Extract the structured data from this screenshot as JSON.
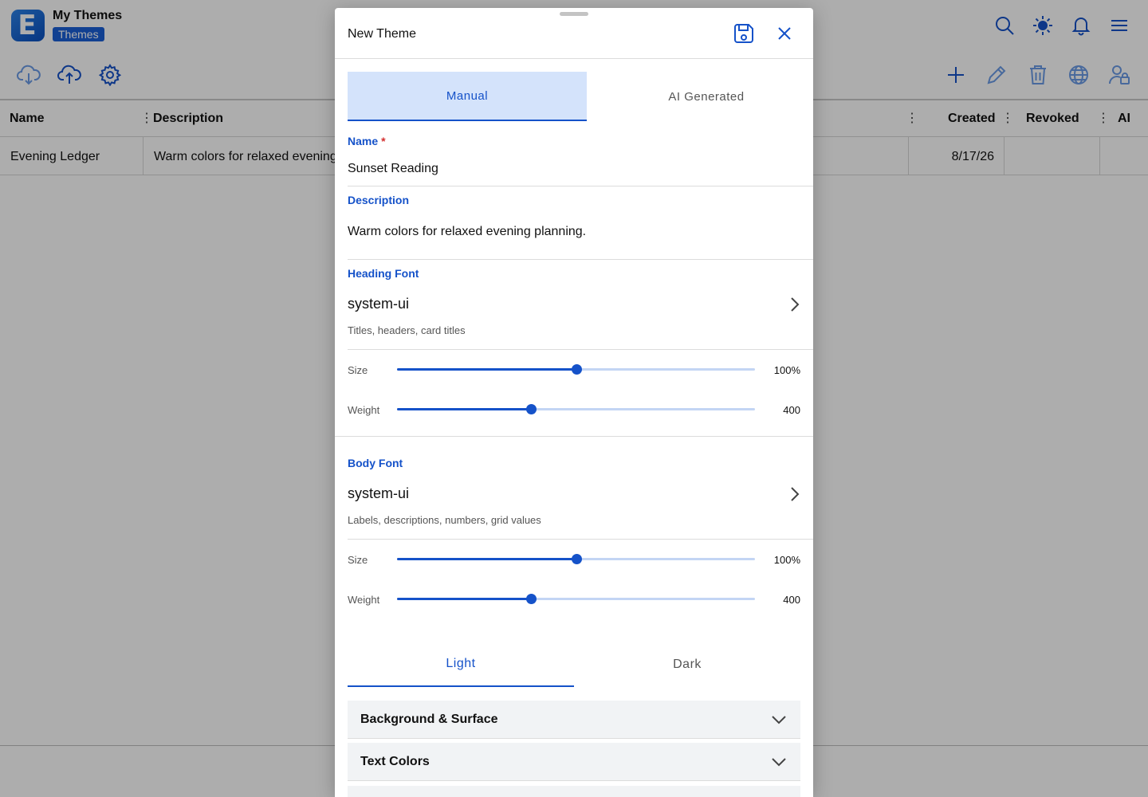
{
  "app": {
    "logo_letter": "E",
    "title": "My Themes",
    "badge": "Themes",
    "brand_color": "#1552c9"
  },
  "header_icons": [
    "search-icon",
    "sun-icon",
    "bell-icon",
    "menu-icon"
  ],
  "toolbar_left_icons": [
    "cloud-download-icon",
    "cloud-upload-icon",
    "gear-icon"
  ],
  "toolbar_right_icons": [
    "plus-icon",
    "pencil-icon",
    "trash-icon",
    "globe-icon",
    "user-lock-icon"
  ],
  "grid": {
    "columns": [
      "Name",
      "Description",
      "Created",
      "Revoked",
      "AI"
    ],
    "rows": [
      {
        "name": "Evening Ledger",
        "description": "Warm colors for relaxed evening planning.",
        "created": "8/17/26",
        "revoked": "",
        "ai": ""
      }
    ]
  },
  "modal": {
    "title": "New Theme",
    "tabs": {
      "manual": "Manual",
      "ai": "AI Generated",
      "active": "manual"
    },
    "name": {
      "label": "Name",
      "required_mark": "*",
      "value": "Sunset Reading"
    },
    "description": {
      "label": "Description",
      "value": "Warm colors for relaxed evening planning."
    },
    "heading_font": {
      "label": "Heading Font",
      "value": "system-ui",
      "hint": "Titles, headers, card titles",
      "size": {
        "label": "Size",
        "value": "100%",
        "fraction": 0.5
      },
      "weight": {
        "label": "Weight",
        "value": "400",
        "fraction": 0.375
      }
    },
    "body_font": {
      "label": "Body Font",
      "value": "system-ui",
      "hint": "Labels, descriptions, numbers, grid values",
      "size": {
        "label": "Size",
        "value": "100%",
        "fraction": 0.5
      },
      "weight": {
        "label": "Weight",
        "value": "400",
        "fraction": 0.375
      }
    },
    "mode_tabs": {
      "light": "Light",
      "dark": "Dark",
      "active": "light"
    },
    "sections": [
      "Background & Surface",
      "Text Colors"
    ]
  }
}
